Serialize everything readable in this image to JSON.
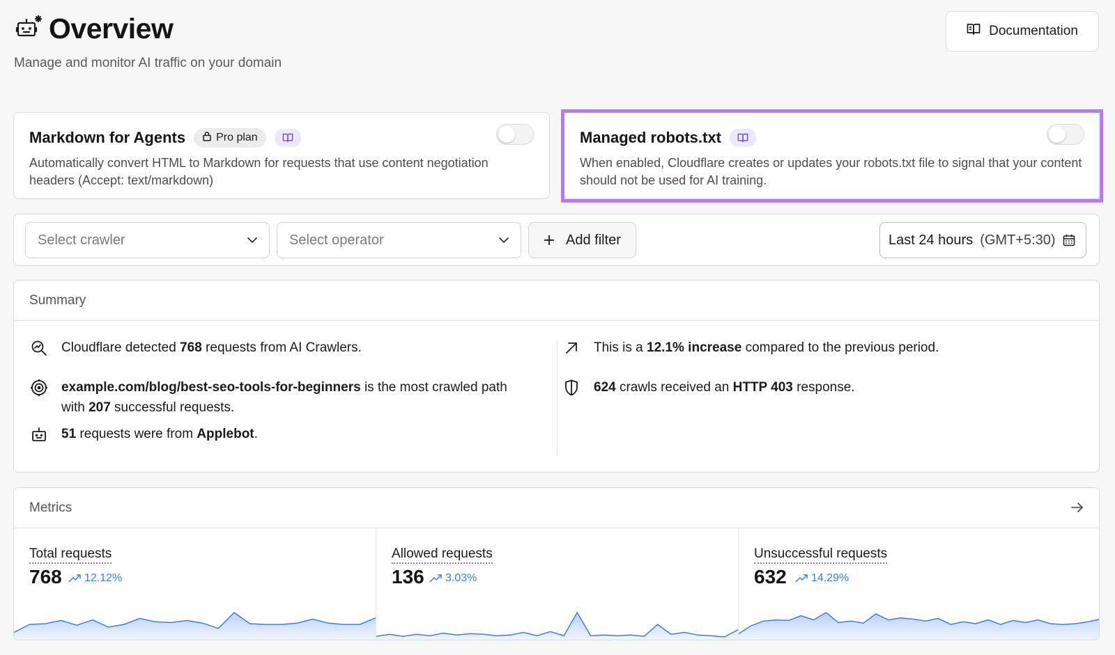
{
  "header": {
    "title": "Overview",
    "subtitle": "Manage and monitor AI traffic on your domain",
    "documentation_label": "Documentation",
    "icon": "robot-sparkle-icon"
  },
  "feature_cards": [
    {
      "title": "Markdown for Agents",
      "badge": "Pro plan",
      "description": "Automatically convert HTML to Markdown for requests that use content negotiation headers (Accept: text/markdown)",
      "enabled": false
    },
    {
      "title": "Managed robots.txt",
      "description": "When enabled, Cloudflare creates or updates your robots.txt file to signal that your content should not be used for AI training.",
      "enabled": false,
      "highlighted": true
    }
  ],
  "filters": {
    "crawler_placeholder": "Select crawler",
    "operator_placeholder": "Select operator",
    "add_filter_label": "Add filter",
    "range_label": "Last 24 hours",
    "range_tz": "(GMT+5:30)"
  },
  "summary": {
    "heading": "Summary",
    "detected": {
      "pre": "Cloudflare detected ",
      "count": "768",
      "post": " requests from AI Crawlers."
    },
    "path": {
      "path": "example.com/blog/best-seo-tools-for-beginners",
      "mid": " is the most crawled path",
      "pre2": "with ",
      "count": "207",
      "post": " successful requests."
    },
    "bot": {
      "count": "51",
      "mid": " requests were from ",
      "name": "Applebot",
      "post": "."
    },
    "increase": {
      "pre": "This is a ",
      "value": "12.1% increase",
      "post": " compared to the previous period."
    },
    "blocked": {
      "count": "624",
      "mid": " crawls received an ",
      "code": "HTTP 403",
      "post": " response."
    }
  },
  "metrics": {
    "heading": "Metrics",
    "items": [
      {
        "label": "Total requests",
        "value": "768",
        "delta": "12.12%",
        "spark": [
          0.25,
          0.55,
          0.58,
          0.7,
          0.52,
          0.72,
          0.45,
          0.55,
          0.78,
          0.65,
          0.62,
          0.7,
          0.6,
          0.4,
          1.0,
          0.58,
          0.55,
          0.55,
          0.6,
          0.75,
          0.6,
          0.55,
          0.55,
          0.8
        ]
      },
      {
        "label": "Allowed requests",
        "value": "136",
        "delta": "3.03%",
        "spark": [
          0.1,
          0.18,
          0.1,
          0.18,
          0.12,
          0.22,
          0.15,
          0.2,
          0.18,
          0.12,
          0.15,
          0.25,
          0.12,
          0.28,
          0.12,
          1.0,
          0.12,
          0.15,
          0.12,
          0.15,
          0.1,
          0.55,
          0.18,
          0.25,
          0.15,
          0.12,
          0.08,
          0.35
        ]
      },
      {
        "label": "Unsuccessful requests",
        "value": "632",
        "delta": "14.29%",
        "spark": [
          0.2,
          0.5,
          0.68,
          0.72,
          0.7,
          0.88,
          0.72,
          1.0,
          0.62,
          0.68,
          0.6,
          0.95,
          0.72,
          0.8,
          0.75,
          0.68,
          0.78,
          0.55,
          0.65,
          0.58,
          0.72,
          0.55,
          0.7,
          0.62,
          0.72,
          0.58,
          0.55,
          0.58,
          0.65,
          0.75
        ]
      }
    ]
  },
  "colors": {
    "accent_blue": "#3f7de2",
    "highlight_purple": "#b57cf2",
    "book_pill": "#ede9fb"
  }
}
